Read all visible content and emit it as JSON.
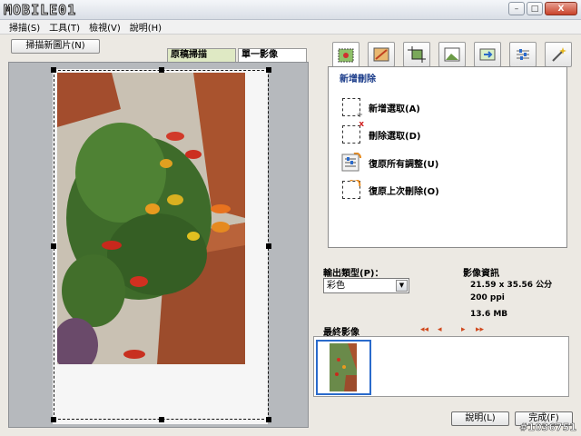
{
  "window": {
    "logo": "MOBILE01",
    "minimize": "–",
    "maximize": "□",
    "close": "X"
  },
  "menu": [
    "掃描(S)",
    "工具(T)",
    "檢視(V)",
    "說明(H)"
  ],
  "left": {
    "scan_new_button": "掃描新圖片(N)",
    "tabs": [
      "原稿掃描",
      "單一影像"
    ]
  },
  "tools": {
    "icons": [
      "crop-delete-icon",
      "color-adjust-icon",
      "crop-icon",
      "image-icon",
      "transfer-icon",
      "slider-settings-icon",
      "magic-wand-icon"
    ],
    "panel_title": "新增刪除",
    "actions": [
      {
        "label": "新增選取(A)",
        "icon": "add-selection-icon"
      },
      {
        "label": "刪除選取(D)",
        "icon": "delete-selection-icon"
      },
      {
        "label": "復原所有調整(U)",
        "icon": "undo-all-icon"
      },
      {
        "label": "復原上次刪除(O)",
        "icon": "undo-last-icon"
      }
    ]
  },
  "output": {
    "label": "輸出類型(P)：",
    "selected": "彩色"
  },
  "image_info": {
    "title": "影像資訊",
    "size": "21.59 x 35.56 公分",
    "resolution": "200 ppi",
    "filesize": "13.6 MB"
  },
  "final": {
    "label": "最終影像",
    "nav": [
      "◂◂",
      "◂",
      "▸",
      "▸▸"
    ]
  },
  "buttons": {
    "help": "說明(L)",
    "done": "完成(F)"
  },
  "watermark": "#1036751",
  "colors": {
    "tab_active": "#dfe9c4",
    "panel_title": "#1b3c8a",
    "nav_arrows": "#d0481c",
    "thumb_border": "#2a6acb"
  }
}
